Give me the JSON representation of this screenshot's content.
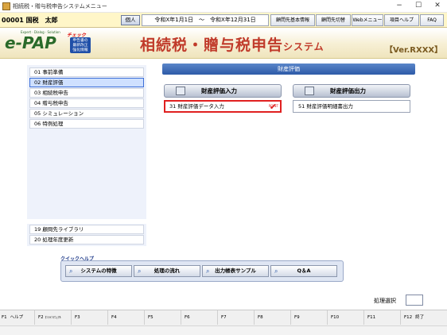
{
  "window": {
    "title": "相続税・贈与税申告システムメニュー",
    "controls": [
      "−",
      "☐",
      "✕"
    ]
  },
  "infobar": {
    "client": "00001 国税　太郎",
    "change_label": "個人",
    "period": "令和X年1月1日　～　令和X年12月31日",
    "buttons": [
      "顧問先基本情報",
      "顧問先切替",
      "Webメニュー",
      "項目ヘルプ",
      "FAQ"
    ]
  },
  "banner": {
    "logo": "e-PAP",
    "logo_tagline": "Expert · Dialog · Solution",
    "check_label": "チェック",
    "check_box_text": "申告書の\n最新改正\n強化情報",
    "title": "相続税・贈与税申告",
    "title_suffix": "システム",
    "version": "【Ver.RXXX】"
  },
  "menu": {
    "items": [
      {
        "label": "01 事前準備"
      },
      {
        "label": "02 財産評価"
      },
      {
        "label": "03 相続税申告"
      },
      {
        "label": "04 贈与税申告"
      },
      {
        "label": "05 シミュレーション"
      },
      {
        "label": "06 特例処理"
      }
    ],
    "bottom_items": [
      {
        "label": "19 顧問先ライブラリ"
      },
      {
        "label": "20 処理年度更新"
      }
    ]
  },
  "main": {
    "header": "財産評価",
    "input_section": {
      "label": "財産評価入力",
      "item": "31 財産評価データ入力",
      "point": "POINT"
    },
    "output_section": {
      "label": "財産評価出力",
      "item": "51 財産評価明細書出力"
    }
  },
  "quickhelp": {
    "label": "クイックヘルプ",
    "buttons": [
      "システムの特徴",
      "処理の流れ",
      "出力帳表サンプル",
      "Q＆A"
    ]
  },
  "process": {
    "label": "処理選択"
  },
  "fkeys": [
    {
      "key": "F1",
      "label": "ヘルプ"
    },
    {
      "key": "F2",
      "label": "ｵﾝﾗｲﾝﾏﾆｭｱﾙ"
    },
    {
      "key": "F3",
      "label": ""
    },
    {
      "key": "F4",
      "label": ""
    },
    {
      "key": "F5",
      "label": ""
    },
    {
      "key": "F6",
      "label": ""
    },
    {
      "key": "F7",
      "label": ""
    },
    {
      "key": "F8",
      "label": ""
    },
    {
      "key": "F9",
      "label": ""
    },
    {
      "key": "F10",
      "label": ""
    },
    {
      "key": "F11",
      "label": ""
    },
    {
      "key": "F12",
      "label": "終了"
    }
  ]
}
